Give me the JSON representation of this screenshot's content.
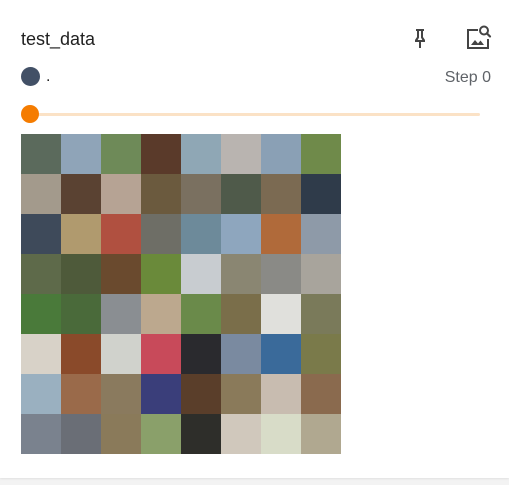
{
  "card": {
    "title": "test_data",
    "run_name": ".",
    "step_label": "Step 0",
    "run_color": "#425066"
  },
  "icons": {
    "pin": "pin-icon",
    "zoom": "image-search-icon"
  },
  "slider": {
    "value": 0,
    "accent": "#f57c00",
    "track": "#fbe2c6"
  },
  "image_grid": {
    "rows": 8,
    "cols": 8,
    "tiles": [
      [
        "#5b6a5c",
        "#8fa4b8",
        "#6e8a58",
        "#5a3a2a",
        "#8fa7b5",
        "#b9b4b0",
        "#8aa0b5",
        "#6f8a4a"
      ],
      [
        "#a39a8c",
        "#5a4232",
        "#b6a394",
        "#6b5a3e",
        "#7a7060",
        "#4f5a4a",
        "#7b6a52",
        "#2f3b4a"
      ],
      [
        "#3e4a5a",
        "#b09a6e",
        "#b05040",
        "#6e6e66",
        "#6d8a9a",
        "#8ea6be",
        "#b06a3a",
        "#8e9aa8"
      ],
      [
        "#5e6a4a",
        "#4e5a3a",
        "#6a4a2e",
        "#6a8a3a",
        "#c8ccd0",
        "#8a8672",
        "#8a8a86",
        "#a8a49c"
      ],
      [
        "#4a7a3a",
        "#4a6a3a",
        "#8a8e92",
        "#bca88e",
        "#6a8a4a",
        "#7a6e4a",
        "#e0e0dc",
        "#7a7a5a"
      ],
      [
        "#d8d2c8",
        "#8a4a2a",
        "#d0d2cc",
        "#c84a5a",
        "#2a2a2e",
        "#7a8aa0",
        "#3a6a9a",
        "#7a7a4a"
      ],
      [
        "#9ab0c0",
        "#9a6a4a",
        "#8a7a5e",
        "#3a3e7a",
        "#5a3e2a",
        "#8a7a5a",
        "#c8bcb0",
        "#8a6a4e"
      ],
      [
        "#7a828e",
        "#6a6e76",
        "#8a7a5a",
        "#8aa06a",
        "#2e2e2a",
        "#d0c8bc",
        "#d8dcc8",
        "#b0a890"
      ]
    ]
  }
}
